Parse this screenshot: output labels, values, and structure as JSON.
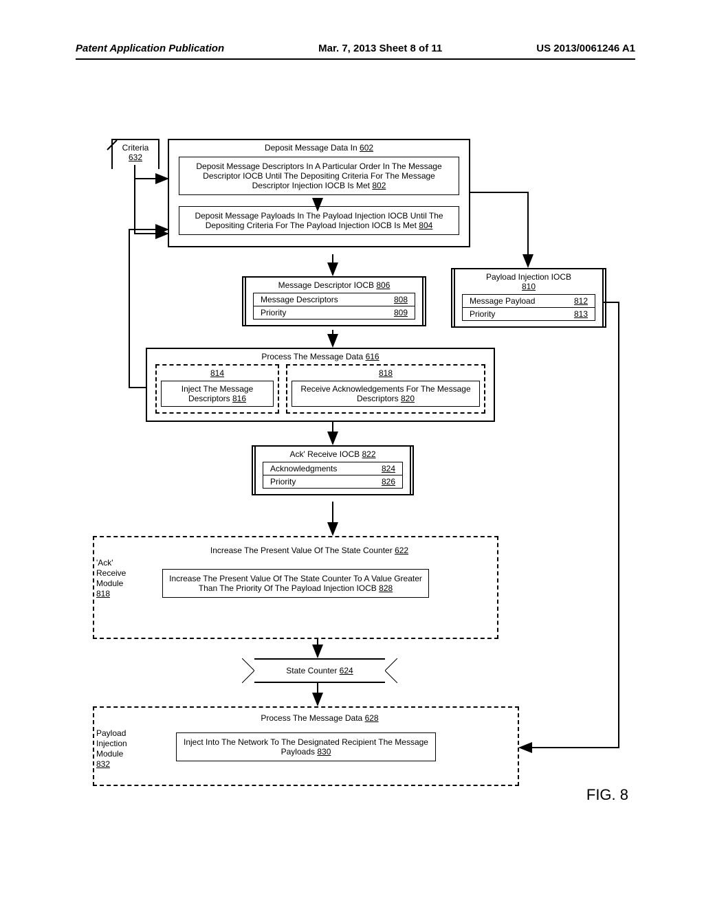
{
  "header": {
    "left": "Patent Application Publication",
    "center": "Mar. 7, 2013  Sheet 8 of 11",
    "right": "US 2013/0061246 A1"
  },
  "fig_label": "FIG. 8",
  "criteria": {
    "label": "Criteria",
    "ref": "632"
  },
  "deposit_outer": {
    "title": "Deposit Message Data In",
    "ref": "602"
  },
  "deposit_inner1": {
    "text": "Deposit Message Descriptors In A Particular Order In The Message Descriptor IOCB Until The Depositing Criteria For The Message Descriptor Injection IOCB Is Met",
    "ref": "802"
  },
  "deposit_inner2": {
    "text": "Deposit Message Payloads In The Payload Injection IOCB Until The Depositing Criteria For The Payload Injection IOCB Is Met",
    "ref": "804"
  },
  "msg_desc_iocb": {
    "title": "Message Descriptor IOCB",
    "title_ref": "806",
    "rows": [
      {
        "label": "Message Descriptors",
        "ref": "808"
      },
      {
        "label": "Priority",
        "ref": "809"
      }
    ]
  },
  "payload_iocb": {
    "title": "Payload Injection IOCB",
    "title_ref": "810",
    "rows": [
      {
        "label": "Message Payload",
        "ref": "812"
      },
      {
        "label": "Priority",
        "ref": "813"
      }
    ]
  },
  "process1": {
    "title": "Process The Message Data",
    "ref": "616"
  },
  "process1_left": {
    "ref": "814",
    "text": "Inject The Message Descriptors",
    "text_ref": "816"
  },
  "process1_right": {
    "ref": "818",
    "text": "Receive Acknowledgements For The Message Descriptors",
    "text_ref": "820"
  },
  "ack_iocb": {
    "title": "Ack' Receive IOCB",
    "title_ref": "822",
    "rows": [
      {
        "label": "Acknowledgments",
        "ref": "824"
      },
      {
        "label": "Priority",
        "ref": "826"
      }
    ]
  },
  "increase_outer": {
    "title": "Increase The Present Value Of The State Counter",
    "ref": "622"
  },
  "increase_inner": {
    "text": "Increase The Present Value Of The State Counter To A Value Greater Than The Priority Of The Payload Injection IOCB",
    "ref": "828"
  },
  "ack_module": {
    "line1": "'Ack'",
    "line2": "Receive",
    "line3": "Module",
    "ref": "818"
  },
  "state_counter": {
    "label": "State Counter",
    "ref": "624"
  },
  "process2": {
    "title": "Process The Message Data",
    "ref": "628"
  },
  "process2_inner": {
    "text": "Inject Into The Network To The Designated Recipient The Message Payloads",
    "ref": "830"
  },
  "payload_module": {
    "line1": "Payload",
    "line2": "Injection",
    "line3": "Module",
    "ref": "832"
  }
}
